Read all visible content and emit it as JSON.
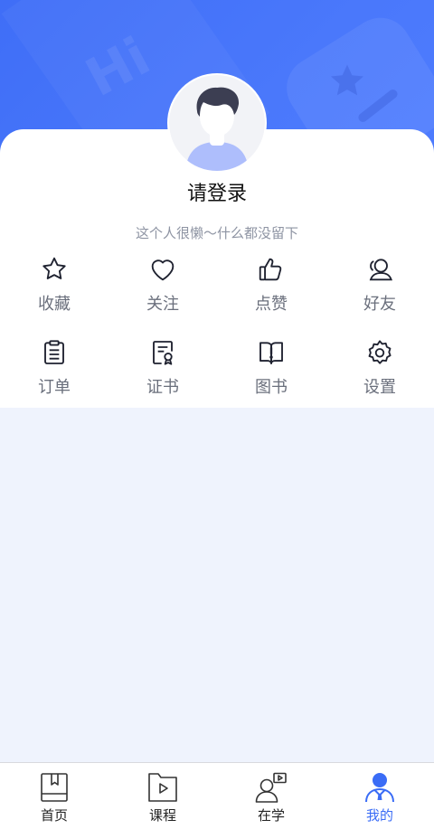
{
  "profile": {
    "name": "请登录",
    "bio": "这个人很懒～什么都没留下",
    "avatar": "default-avatar-icon"
  },
  "decor": {
    "hi_text": "Hi"
  },
  "menu": [
    {
      "label": "收藏",
      "icon": "star-icon"
    },
    {
      "label": "关注",
      "icon": "heart-icon"
    },
    {
      "label": "点赞",
      "icon": "thumbs-up-icon"
    },
    {
      "label": "好友",
      "icon": "friends-icon"
    },
    {
      "label": "订单",
      "icon": "clipboard-icon"
    },
    {
      "label": "证书",
      "icon": "certificate-icon"
    },
    {
      "label": "图书",
      "icon": "book-icon"
    },
    {
      "label": "设置",
      "icon": "gear-icon"
    }
  ],
  "tabbar": {
    "active_index": 3,
    "tabs": [
      {
        "label": "首页",
        "icon": "home-book-icon"
      },
      {
        "label": "课程",
        "icon": "course-play-icon"
      },
      {
        "label": "在学",
        "icon": "learning-icon"
      },
      {
        "label": "我的",
        "icon": "profile-icon"
      }
    ]
  },
  "colors": {
    "brand": "#3f6ef7",
    "active_tab": "#3a6cf6",
    "menu_label": "#6a6f7c",
    "bio_text": "#8e94a3",
    "page_bg": "#eff3fd"
  }
}
